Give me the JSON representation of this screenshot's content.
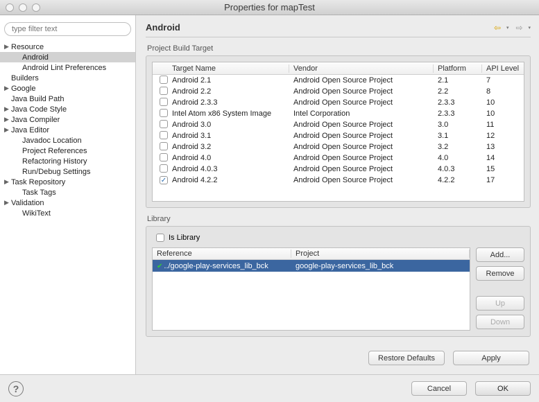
{
  "window": {
    "title": "Properties for mapTest"
  },
  "filter": {
    "placeholder": "type filter text"
  },
  "tree": [
    {
      "label": "Resource",
      "exp": true,
      "level": 0
    },
    {
      "label": "Android",
      "level": 1,
      "selected": true
    },
    {
      "label": "Android Lint Preferences",
      "level": 1
    },
    {
      "label": "Builders",
      "level": 0
    },
    {
      "label": "Google",
      "exp": true,
      "level": 0
    },
    {
      "label": "Java Build Path",
      "level": 0
    },
    {
      "label": "Java Code Style",
      "exp": true,
      "level": 0
    },
    {
      "label": "Java Compiler",
      "exp": true,
      "level": 0
    },
    {
      "label": "Java Editor",
      "exp": true,
      "level": 0
    },
    {
      "label": "Javadoc Location",
      "level": 1
    },
    {
      "label": "Project References",
      "level": 1
    },
    {
      "label": "Refactoring History",
      "level": 1
    },
    {
      "label": "Run/Debug Settings",
      "level": 1
    },
    {
      "label": "Task Repository",
      "exp": true,
      "level": 0
    },
    {
      "label": "Task Tags",
      "level": 1
    },
    {
      "label": "Validation",
      "exp": true,
      "level": 0
    },
    {
      "label": "WikiText",
      "level": 1
    }
  ],
  "page": {
    "heading": "Android"
  },
  "buildTarget": {
    "groupLabel": "Project Build Target",
    "columns": {
      "name": "Target Name",
      "vendor": "Vendor",
      "platform": "Platform",
      "api": "API Level"
    },
    "rows": [
      {
        "checked": false,
        "name": "Android 2.1",
        "vendor": "Android Open Source Project",
        "platform": "2.1",
        "api": "7"
      },
      {
        "checked": false,
        "name": "Android 2.2",
        "vendor": "Android Open Source Project",
        "platform": "2.2",
        "api": "8"
      },
      {
        "checked": false,
        "name": "Android 2.3.3",
        "vendor": "Android Open Source Project",
        "platform": "2.3.3",
        "api": "10"
      },
      {
        "checked": false,
        "name": "Intel Atom x86 System Image",
        "vendor": "Intel Corporation",
        "platform": "2.3.3",
        "api": "10"
      },
      {
        "checked": false,
        "name": "Android 3.0",
        "vendor": "Android Open Source Project",
        "platform": "3.0",
        "api": "11"
      },
      {
        "checked": false,
        "name": "Android 3.1",
        "vendor": "Android Open Source Project",
        "platform": "3.1",
        "api": "12"
      },
      {
        "checked": false,
        "name": "Android 3.2",
        "vendor": "Android Open Source Project",
        "platform": "3.2",
        "api": "13"
      },
      {
        "checked": false,
        "name": "Android 4.0",
        "vendor": "Android Open Source Project",
        "platform": "4.0",
        "api": "14"
      },
      {
        "checked": false,
        "name": "Android 4.0.3",
        "vendor": "Android Open Source Project",
        "platform": "4.0.3",
        "api": "15"
      },
      {
        "checked": true,
        "name": "Android 4.2.2",
        "vendor": "Android Open Source Project",
        "platform": "4.2.2",
        "api": "17"
      }
    ]
  },
  "library": {
    "groupLabel": "Library",
    "isLibraryLabel": "Is Library",
    "isLibraryChecked": false,
    "columns": {
      "reference": "Reference",
      "project": "Project"
    },
    "rows": [
      {
        "reference": "../google-play-services_lib_bck",
        "project": "google-play-services_lib_bck",
        "status": "ok",
        "selected": true
      }
    ],
    "buttons": {
      "add": "Add...",
      "remove": "Remove",
      "up": "Up",
      "down": "Down"
    }
  },
  "bottom": {
    "restore": "Restore Defaults",
    "apply": "Apply"
  },
  "footer": {
    "cancel": "Cancel",
    "ok": "OK"
  }
}
